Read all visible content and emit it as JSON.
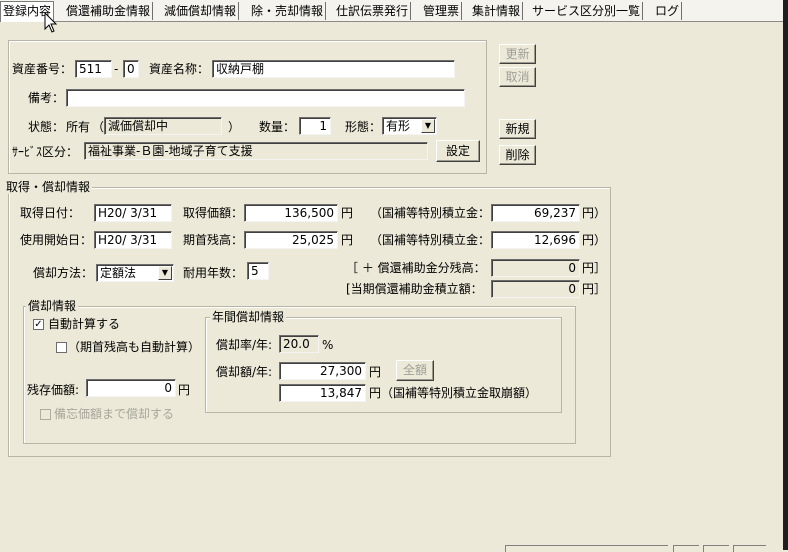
{
  "tabs": [
    "登録内容",
    "償還補助金情報",
    "減価償却情報",
    "除・売却情報",
    "仕訳伝票発行",
    "管理票",
    "集計情報",
    "サービス区分別一覧",
    "ログ"
  ],
  "top": {
    "asset_no_label": "資産番号：",
    "asset_no": "511",
    "asset_no_sep": "-",
    "asset_no_sub": "0",
    "asset_name_label": "資産名称：",
    "asset_name": "収納戸棚",
    "memo_label": "備考：",
    "memo": "",
    "status_label": "状態：",
    "status_value": "所有",
    "status_paren_open": "（",
    "status_detail": "減価償却中",
    "status_paren_close": "）",
    "qty_label": "数量：",
    "qty": "1",
    "form_label": "形態：",
    "form_value": "有形",
    "service_label": "ｻｰﾋﾞｽ区分：",
    "service_value": "福祉事業-Ｂ園-地域子育て支援",
    "setting_button": "設定",
    "update_button": "更新",
    "cancel_button": "取消",
    "new_button": "新規",
    "delete_button": "削除"
  },
  "acq": {
    "legend": "取得・償却情報",
    "acq_date_label": "取得日付：",
    "acq_date": "H20/ 3/31",
    "acq_price_label": "取得価額：",
    "acq_price": "136,500",
    "yen": "円",
    "subsidy_reserve_label1": "（国補等特別積立金：",
    "subsidy_reserve1": "69,237",
    "yen_paren": "円）",
    "start_date_label": "使用開始日：",
    "start_date": "H20/ 3/31",
    "opening_balance_label": "期首残高：",
    "opening_balance": "25,025",
    "subsidy_reserve_label2": "（国補等特別積立金：",
    "subsidy_reserve2": "12,696",
    "method_label": "償却方法：",
    "method_value": "定額法",
    "life_label": "耐用年数：",
    "life_value": "5",
    "repay_balance_label": "［ ＋ 償還補助金分残高：",
    "repay_balance": "0",
    "bracket_yen": "円］",
    "period_repay_label": "[当期償還補助金積立額：",
    "period_repay": "0"
  },
  "dep": {
    "legend": "償却情報",
    "auto_calc_label": "自動計算する",
    "auto_calc_mark": "✓",
    "auto_opening_label": "（期首残高も自動計算）",
    "residual_label": "残存価額:",
    "residual_value": "0",
    "yen": "円",
    "memo_value_label": "備忘価額まで償却する",
    "annual_legend": "年間償却情報",
    "rate_label": "償却率/年:",
    "rate_value": "20.0",
    "percent": "%",
    "amount_label": "償却額/年:",
    "amount_value": "27,300",
    "full_button": "全額",
    "reversal_value": "13,847",
    "reversal_label": "円（国補等特別積立金取崩額）"
  }
}
